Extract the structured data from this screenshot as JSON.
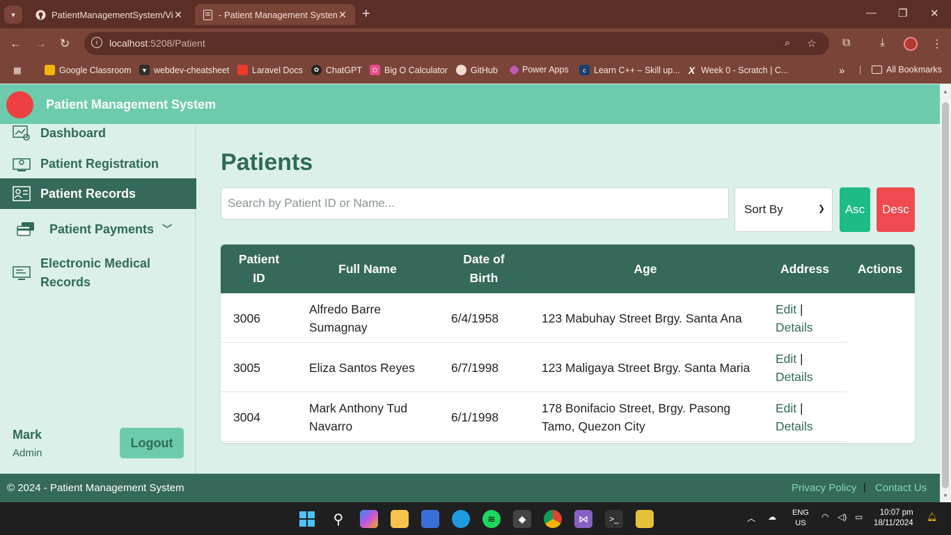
{
  "browser": {
    "tabs": [
      {
        "label": "PatientManagementSystem/Vie",
        "icon": "github-icon"
      },
      {
        "label": "- Patient Management System",
        "icon": "page-icon"
      }
    ],
    "url_host": "localhost",
    "url_path": ":5208/Patient",
    "bookmarks": [
      {
        "label": "Google Classroom",
        "color": "#f4b400"
      },
      {
        "label": "webdev-cheatsheet",
        "color": "#2e2e2e"
      },
      {
        "label": "Laravel Docs",
        "color": "#ef3b2d"
      },
      {
        "label": "ChatGPT",
        "color": "#222"
      },
      {
        "label": "Big O Calculator",
        "color": "#e94c89"
      },
      {
        "label": "GitHub",
        "color": "#222"
      },
      {
        "label": "Power Apps",
        "color": "#742774"
      },
      {
        "label": "Learn C++ – Skill up...",
        "color": "#1c3f6e"
      },
      {
        "label": "Week 0 - Scratch | C...",
        "color": "#222"
      }
    ],
    "all_bookmarks": "All Bookmarks"
  },
  "app": {
    "title": "Patient Management System",
    "accent": "#6dcbad",
    "dark": "#35695a"
  },
  "sidebar": {
    "items": [
      {
        "label": "Dashboard",
        "icon": "dashboard-icon"
      },
      {
        "label": "Patient Registration",
        "icon": "registration-icon"
      },
      {
        "label": "Patient Records",
        "icon": "records-icon",
        "active": true
      },
      {
        "label": "Patient Payments",
        "icon": "payments-icon",
        "has_dropdown": true
      },
      {
        "label_line1": "Electronic Medical",
        "label_line2": "Records",
        "icon": "emr-icon"
      }
    ],
    "user": {
      "name": "Mark",
      "role": "Admin"
    },
    "logout_label": "Logout"
  },
  "main": {
    "title": "Patients",
    "search_placeholder": "Search by Patient ID or Name...",
    "sort_label": "Sort By",
    "asc_label": "Asc",
    "desc_label": "Desc",
    "table": {
      "headers": {
        "id_line1": "Patient",
        "id_line2": "ID",
        "name": "Full Name",
        "dob_line1": "Date of",
        "dob_line2": "Birth",
        "age": "Age",
        "address": "Address",
        "actions": "Actions"
      },
      "rows": [
        {
          "id": "3006",
          "name_line1": "Alfredo Barre",
          "name_line2": "Sumagnay",
          "dob": "6/4/1958",
          "address_line1": "123 Mabuhay Street Brgy. Santa Ana",
          "address_line2": "",
          "edit": "Edit",
          "sep": "|",
          "details": "Details"
        },
        {
          "id": "3005",
          "name_line1": "Eliza Santos Reyes",
          "name_line2": "",
          "dob": "6/7/1998",
          "address_line1": "123 Maligaya Street Brgy. Santa Maria",
          "address_line2": "",
          "edit": "Edit",
          "sep": "|",
          "details": "Details"
        },
        {
          "id": "3004",
          "name_line1": "Mark Anthony Tud",
          "name_line2": "Navarro",
          "dob": "6/1/1998",
          "address_line1": "178 Bonifacio Street, Brgy. Pasong",
          "address_line2": "Tamo, Quezon City",
          "edit": "Edit",
          "sep": "|",
          "details": "Details"
        }
      ]
    }
  },
  "footer": {
    "copyright": "© 2024 - Patient Management System",
    "privacy": "Privacy Policy",
    "sep": "|",
    "contact": "Contact Us"
  },
  "taskbar": {
    "lang_line1": "ENG",
    "lang_line2": "US",
    "time": "10:07 pm",
    "date": "18/11/2024"
  }
}
